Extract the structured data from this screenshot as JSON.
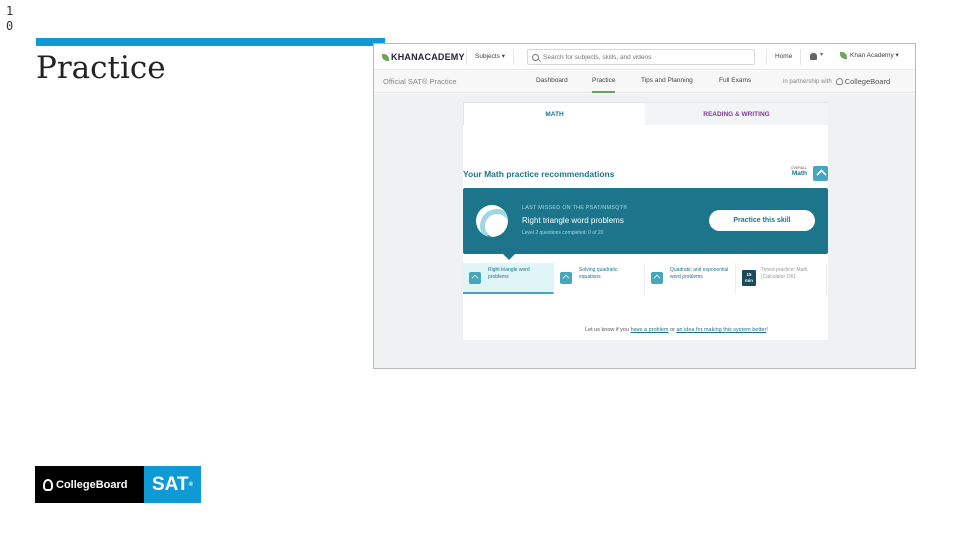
{
  "slide": {
    "number": "10",
    "title": "Practice"
  },
  "ka_nav": {
    "logo": "KHANACADEMY",
    "subjects": "Subjects ▾",
    "search_placeholder": "Search for subjects, skills, and videos",
    "home": "Home",
    "bell_caret": "▾",
    "profile": "Khan Academy ▾"
  },
  "sat_nav": {
    "title": "Official SAT® Practice",
    "tabs": [
      "Dashboard",
      "Practice",
      "Tips and Planning",
      "Full Exams"
    ],
    "active_tab": "Practice",
    "partnership": "in partnership with",
    "partner_name": "CollegeBoard"
  },
  "card": {
    "tabs": [
      "MATH",
      "READING & WRITING"
    ],
    "heading": "Your Math practice recommendations",
    "overall_label": "OVERALL",
    "overall_value": "Math",
    "banner": {
      "kicker": "LAST MISSED ON THE PSAT/NMSQT®",
      "skill": "Right triangle word problems",
      "level": "Level 2 questions completed: 0 of 20",
      "button": "Practice this skill"
    },
    "skills": [
      {
        "label": "Right triangle word problems",
        "active": true
      },
      {
        "label": "Solving quadratic equations",
        "active": false
      },
      {
        "label": "Quadratic and exponential word problems",
        "active": false
      },
      {
        "label": "Timed practice: Math (Calculator OK)",
        "badge": "15 min",
        "active": false
      }
    ],
    "feedback": {
      "prefix": "Let us know if you",
      "link1": "have a problem",
      "middle": "or",
      "link2": "an idea for making this system better",
      "suffix": "!"
    }
  },
  "footer_logo": {
    "collegeboard": "CollegeBoard",
    "sat": "SAT",
    "sat_mark": "®"
  },
  "colors": {
    "accent_blue": "#0f9ad6",
    "ka_teal": "#1c758a",
    "ka_green": "#68a35a",
    "rw_purple": "#7b3f92"
  }
}
